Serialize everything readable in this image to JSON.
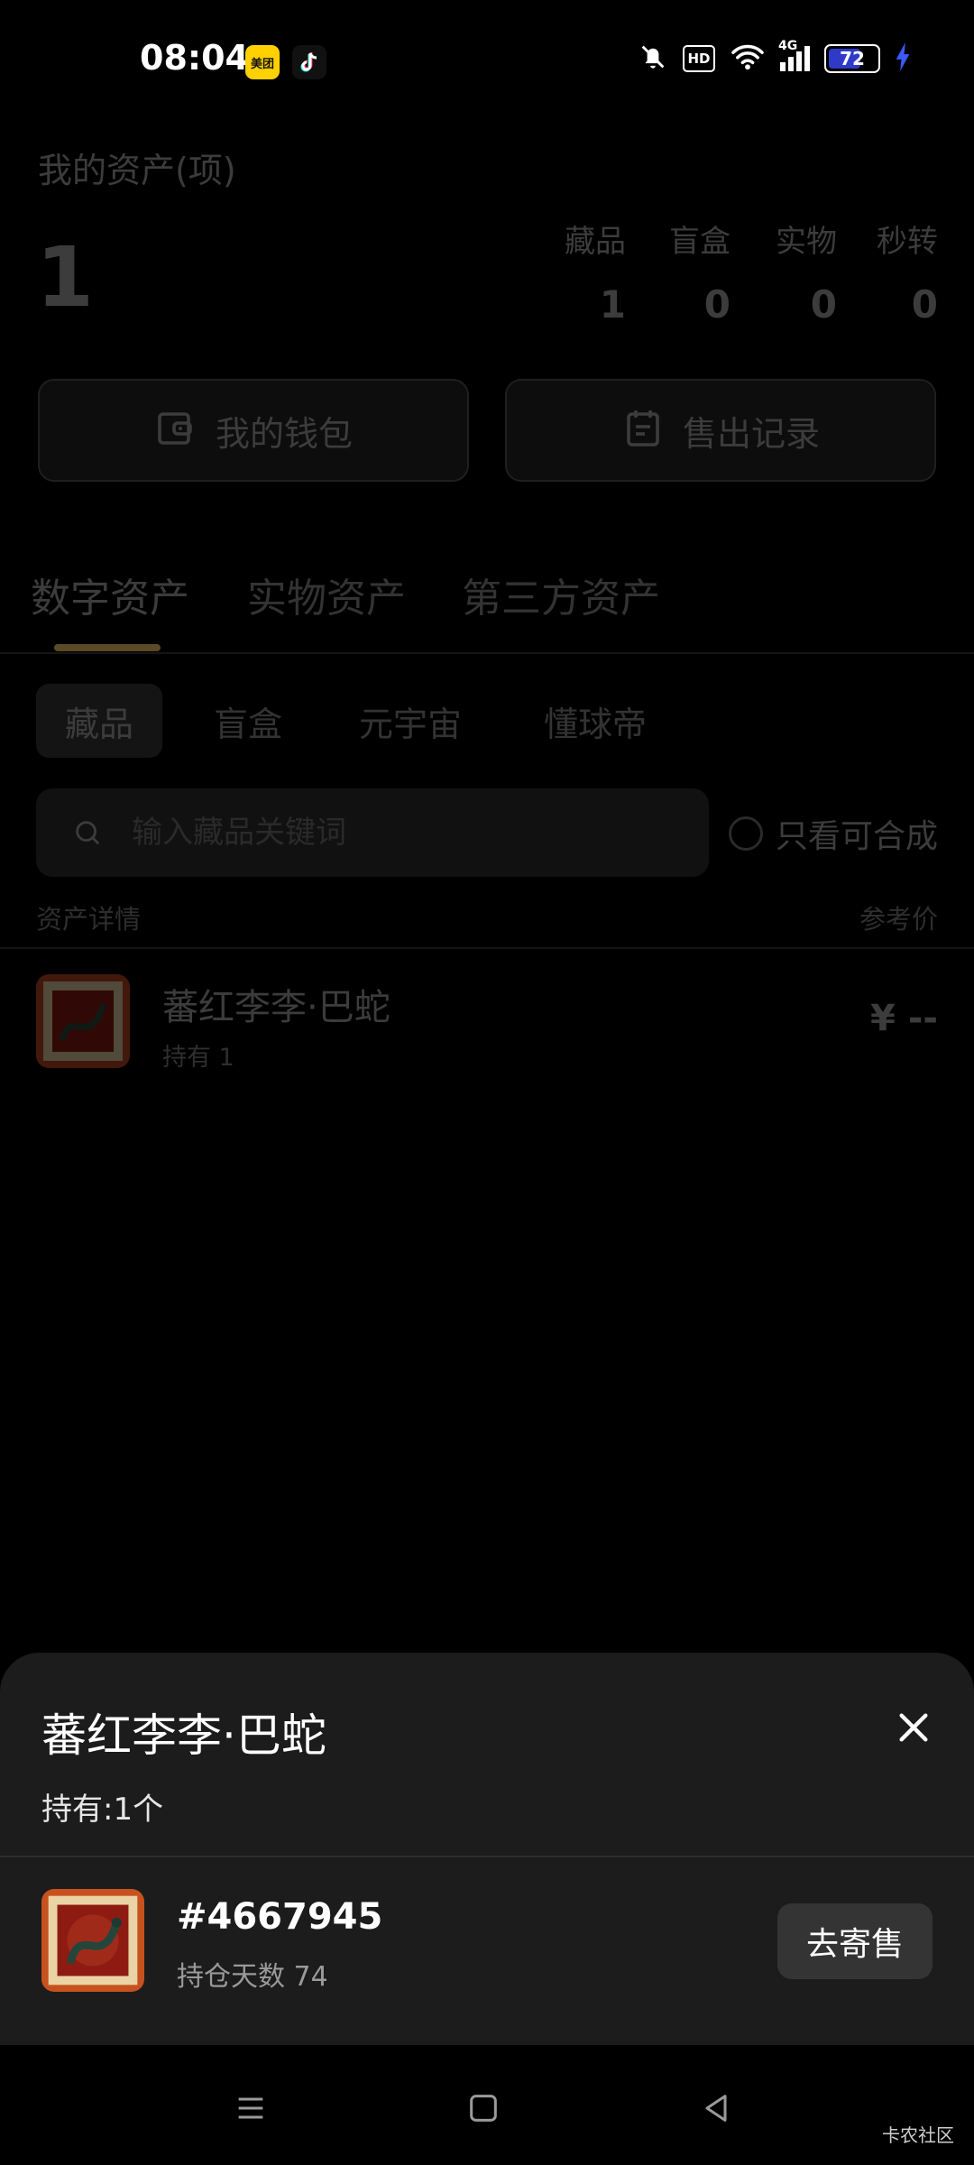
{
  "status_bar": {
    "time": "08:04",
    "meituan_label": "美团",
    "hd_label": "HD",
    "network_label": "4G",
    "battery": "72",
    "battery_level": 0.72,
    "icons": [
      "bell-muted-icon",
      "hd-icon",
      "wifi-icon",
      "signal-icon",
      "battery-icon",
      "charging-icon"
    ]
  },
  "summary": {
    "title": "我的资产(项)",
    "total": "1",
    "stats": [
      {
        "label": "藏品",
        "value": "1"
      },
      {
        "label": "盲盒",
        "value": "0"
      },
      {
        "label": "实物",
        "value": "0"
      },
      {
        "label": "秒转",
        "value": "0"
      }
    ]
  },
  "actions": {
    "wallet": "我的钱包",
    "sales_record": "售出记录"
  },
  "main_tabs": [
    "数字资产",
    "实物资产",
    "第三方资产"
  ],
  "active_main_tab": 0,
  "sub_tabs": [
    "藏品",
    "盲盒",
    "元宇宙",
    "懂球帝"
  ],
  "active_sub_tab": 0,
  "search": {
    "placeholder": "输入藏品关键词",
    "only_combinable": "只看可合成"
  },
  "list": {
    "header_left": "资产详情",
    "header_right": "参考价",
    "items": [
      {
        "name": "蕃红李李·巴蛇",
        "holding": "持有 1",
        "price": "¥ --"
      }
    ]
  },
  "sheet": {
    "title": "蕃红李李·巴蛇",
    "holding": "持有:1个",
    "serial": "#4667945",
    "days": "持仓天数 74",
    "sell_button": "去寄售"
  },
  "watermark": "卡农社区",
  "colors": {
    "background": "#000000",
    "sheet_bg": "#1c1c1c",
    "sell_button_bg": "#343434",
    "tab_underline": "#c9a24a",
    "battery_fill": "#2f3ac9",
    "charging_bolt": "#3b5bff"
  }
}
